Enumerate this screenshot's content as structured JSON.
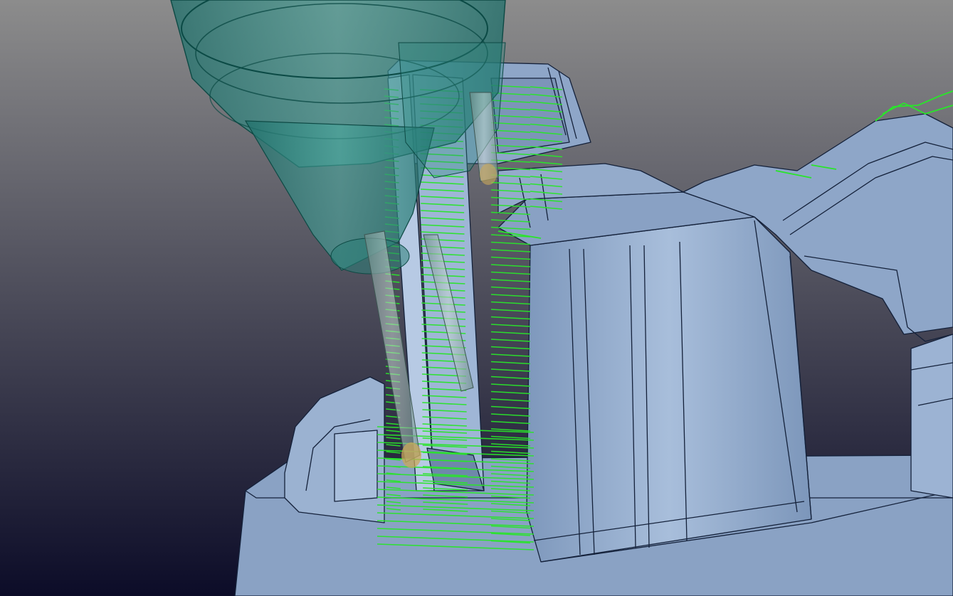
{
  "viewport": {
    "name": "3d-viewport",
    "background_top": "#8c8c8c",
    "background_bottom": "#0c0c28"
  },
  "colors": {
    "part_face": "#8ea6c6",
    "part_face_light": "#a6bcd8",
    "part_face_shadow": "#6f88aa",
    "part_edge": "#14213a",
    "toolpath": "#29e52a",
    "holder": "#2f8a82",
    "tool_tip": "#c9a85a"
  },
  "icons": {
    "spindle": "spindle-holder-icon",
    "cutter": "cutting-tool-icon",
    "part": "workpiece-part-icon",
    "toolpath": "toolpath-lines-icon"
  }
}
